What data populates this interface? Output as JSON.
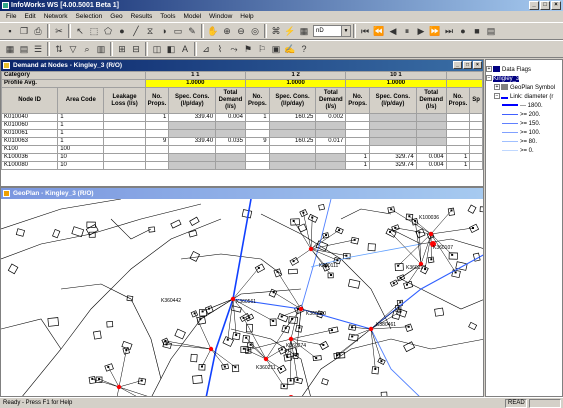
{
  "app": {
    "title": "InfoWorks WS [4.00.5001 Beta 1]"
  },
  "menu": [
    "File",
    "Edit",
    "Network",
    "Selection",
    "Geo",
    "Results",
    "Tools",
    "Model",
    "Window",
    "Help"
  ],
  "toolbar": {
    "combo_value": "nD"
  },
  "demand_window": {
    "title": "Demand at Nodes - Kingley_3 (R/O)",
    "row_category": "Category",
    "row_profile": "Profile Avg.",
    "groups": [
      {
        "category": "1    1",
        "profile": "1.0000"
      },
      {
        "category": "1    2",
        "profile": "1.0000"
      },
      {
        "category": "10    1",
        "profile": "1.0000"
      }
    ],
    "columns": [
      "Node ID",
      "Area Code",
      "Leakage Loss (l/s)",
      "No. Props.",
      "Spec. Cons. (l/p/day)",
      "Total Demand (l/s)",
      "No. Props.",
      "Spec. Cons. (l/p/day)",
      "Total Demand (l/s)",
      "No. Props.",
      "Spec. Cons. (l/p/day)",
      "Total Demand (l/s)",
      "No. Props.",
      "Sp"
    ],
    "rows": [
      [
        "K010040",
        "1",
        "",
        "1",
        "339.40",
        "0.004",
        "1",
        "160.25",
        "0.002",
        "",
        "",
        "",
        "",
        ""
      ],
      [
        "K010060",
        "1",
        "",
        "",
        "",
        "",
        "",
        "",
        "",
        "",
        "",
        "",
        "",
        ""
      ],
      [
        "K010061",
        "1",
        "",
        "",
        "",
        "",
        "",
        "",
        "",
        "",
        "",
        "",
        "",
        ""
      ],
      [
        "K010063",
        "1",
        "",
        "9",
        "339.40",
        "0.035",
        "9",
        "160.25",
        "0.017",
        "",
        "",
        "",
        "",
        ""
      ],
      [
        "K100",
        "100",
        "",
        "",
        "",
        "",
        "",
        "",
        "",
        "",
        "",
        "",
        "",
        ""
      ],
      [
        "K100036",
        "10",
        "",
        "",
        "",
        "",
        "",
        "",
        "",
        "1",
        "329.74",
        "0.004",
        "1",
        ""
      ],
      [
        "K100080",
        "10",
        "",
        "",
        "",
        "",
        "",
        "",
        "",
        "1",
        "329.74",
        "0.004",
        "1",
        ""
      ]
    ]
  },
  "geoplan_window": {
    "title": "GeoPlan - Kingley_3 (R/O)",
    "node_labels": [
      "K360111",
      "K100036",
      "K360000",
      "K360442",
      "K360211",
      "K360274",
      "K360561",
      "K380461",
      "K360197",
      "K360107"
    ]
  },
  "layers": {
    "items": [
      {
        "label": "Data Flags"
      },
      {
        "label": "Kingley_3"
      },
      {
        "label": "GeoPlan Symbol"
      },
      {
        "label": "Link: diameter (r"
      },
      {
        "label": "--- 1800.",
        "color": "#0000ff"
      },
      {
        "label": ">= 200.",
        "color": "#4060ff"
      },
      {
        "label": ">= 150.",
        "color": "#6080ff"
      },
      {
        "label": ">= 100.",
        "color": "#80a0ff"
      },
      {
        "label": ">= 80.",
        "color": "#a0c0ff"
      },
      {
        "label": ">= 0.",
        "color": "#c0d8ff"
      }
    ]
  },
  "status": {
    "left": "Ready - Press F1 for Help",
    "mode": "READ"
  }
}
